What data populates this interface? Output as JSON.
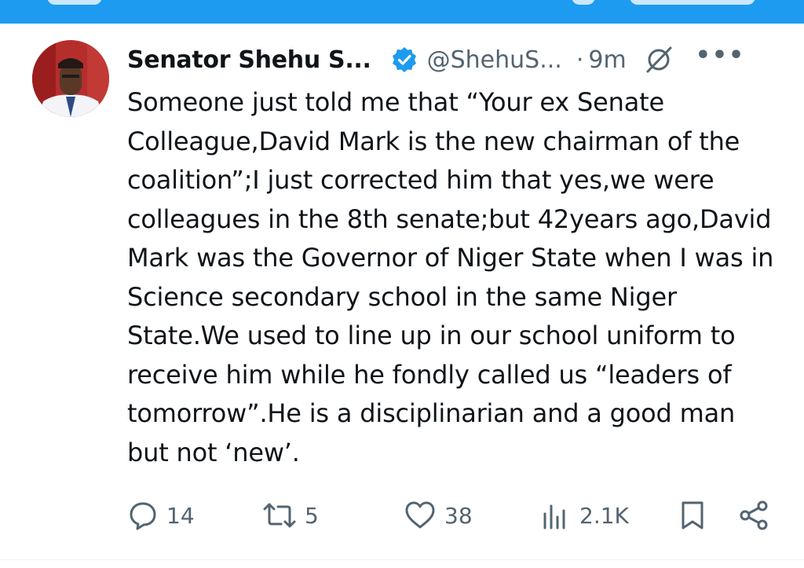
{
  "post": {
    "author_name": "Senator Shehu S...",
    "handle": "@ShehuS...",
    "separator": "·",
    "time": "9m",
    "more_label": "•••",
    "text": "Someone just told me that “Your ex Senate Colleague,David Mark is the new chairman of the coalition”;I just corrected him that yes,we were colleagues in the 8th senate;but 42years ago,David Mark was the Governor of Niger State when I was in Science secondary school in the same Niger State.We used to line up in our school uniform to receive him while he fondly called us “leaders of tomorrow”.He is a disciplinarian and a good man but not ‘new’."
  },
  "actions": {
    "replies": "14",
    "reposts": "5",
    "likes": "38",
    "views": "2.1K"
  },
  "colors": {
    "accent": "#1d9bf0",
    "text": "#0f1419",
    "muted": "#536471"
  },
  "icons": [
    "verified-badge-icon",
    "grok-icon",
    "more-icon",
    "reply-icon",
    "repost-icon",
    "like-icon",
    "views-icon",
    "bookmark-icon",
    "share-icon"
  ]
}
